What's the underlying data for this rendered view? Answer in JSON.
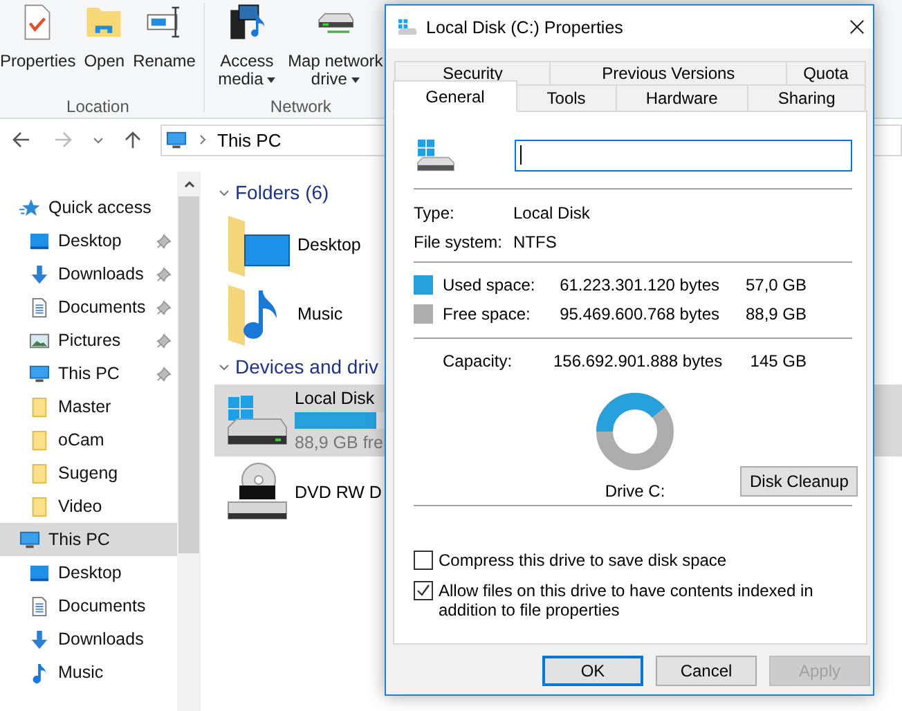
{
  "ribbon": {
    "groups": [
      {
        "label": "Location",
        "buttons": [
          {
            "label": "Properties",
            "kind": "properties",
            "dropdown": false
          },
          {
            "label": "Open",
            "kind": "open",
            "dropdown": false
          },
          {
            "label": "Rename",
            "kind": "rename",
            "dropdown": false
          }
        ]
      },
      {
        "label": "Network",
        "buttons": [
          {
            "label": "Access media",
            "kind": "media",
            "dropdown": true
          },
          {
            "label": "Map network drive",
            "kind": "netdrive",
            "dropdown": true
          }
        ]
      }
    ]
  },
  "address": {
    "path": "This PC"
  },
  "sidebar": {
    "sections": [
      {
        "label": "Quick access",
        "kind": "star",
        "selected": false,
        "children": [
          {
            "label": "Desktop",
            "kind": "desktop",
            "pinned": true
          },
          {
            "label": "Downloads",
            "kind": "download",
            "pinned": true
          },
          {
            "label": "Documents",
            "kind": "documents",
            "pinned": true
          },
          {
            "label": "Pictures",
            "kind": "pictures",
            "pinned": true
          },
          {
            "label": "This PC",
            "kind": "pc",
            "pinned": true
          },
          {
            "label": "Master",
            "kind": "folder",
            "pinned": false
          },
          {
            "label": "oCam",
            "kind": "folder",
            "pinned": false
          },
          {
            "label": "Sugeng",
            "kind": "folder",
            "pinned": false
          },
          {
            "label": "Video",
            "kind": "folder",
            "pinned": false
          }
        ]
      },
      {
        "label": "This PC",
        "kind": "pc",
        "selected": true,
        "children": [
          {
            "label": "Desktop",
            "kind": "desktop",
            "pinned": false
          },
          {
            "label": "Documents",
            "kind": "documents",
            "pinned": false
          },
          {
            "label": "Downloads",
            "kind": "download",
            "pinned": false
          },
          {
            "label": "Music",
            "kind": "music",
            "pinned": false
          }
        ]
      }
    ]
  },
  "content": {
    "groups": [
      {
        "label": "Folders (6)",
        "expanded": true,
        "items": [
          {
            "label": "Desktop",
            "kind": "desktop-folder",
            "selected": false
          },
          {
            "label": "Music",
            "kind": "music-folder",
            "selected": false
          }
        ]
      },
      {
        "label": "Devices and driv",
        "expanded": true,
        "items": [
          {
            "label": "Local Disk",
            "kind": "disk",
            "selected": true,
            "level": 0.39,
            "detail": "88,9 GB fre"
          },
          {
            "label": "DVD RW D",
            "kind": "dvd",
            "selected": false
          }
        ]
      }
    ]
  },
  "dialog": {
    "title": "Local Disk (C:) Properties",
    "tab_rows": [
      [
        {
          "label": "Security",
          "selected": false
        },
        {
          "label": "Previous Versions",
          "selected": false
        },
        {
          "label": "Quota",
          "selected": false
        }
      ],
      [
        {
          "label": "General",
          "selected": true
        },
        {
          "label": "Tools",
          "selected": false
        },
        {
          "label": "Hardware",
          "selected": false
        },
        {
          "label": "Sharing",
          "selected": false
        }
      ]
    ],
    "info": [
      {
        "label": "Type:",
        "value": "Local Disk"
      },
      {
        "label": "File system:",
        "value": "NTFS"
      }
    ],
    "space": [
      {
        "label": "Used space:",
        "bytes": "61.223.301.120 bytes",
        "size": "57,0 GB",
        "color": "#26a0da"
      },
      {
        "label": "Free space:",
        "bytes": "95.469.600.768 bytes",
        "size": "88,9 GB",
        "color": "#adadad"
      }
    ],
    "capacity": {
      "label": "Capacity:",
      "bytes": "156.692.901.888 bytes",
      "size": "145 GB"
    },
    "usage_chart": {
      "level": 0.39,
      "caption": "Drive C:"
    },
    "cleanup_button": "Disk Cleanup",
    "options": [
      {
        "label": "Compress this drive to save disk space",
        "checked": false
      },
      {
        "label": "Allow files on this drive to have contents indexed in addition to file properties",
        "checked": true
      }
    ],
    "buttons": [
      {
        "label": "OK",
        "default": true,
        "disabled": false
      },
      {
        "label": "Cancel",
        "default": false,
        "disabled": false
      },
      {
        "label": "Apply",
        "default": false,
        "disabled": true
      }
    ]
  }
}
